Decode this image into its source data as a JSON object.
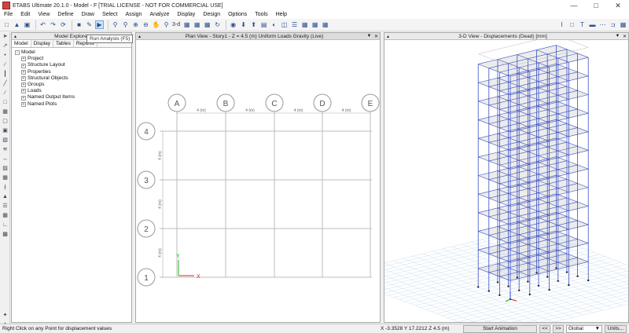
{
  "window": {
    "title": "ETABS Ultimate 20.1.0 - Model - F  [TRIAL LICENSE - NOT FOR COMMERCIAL USE]"
  },
  "menu": [
    "File",
    "Edit",
    "View",
    "Define",
    "Draw",
    "Select",
    "Assign",
    "Analyze",
    "Display",
    "Design",
    "Options",
    "Tools",
    "Help"
  ],
  "toolbar": {
    "view3d_label": "3-d",
    "tooltip": "Run Analysis (F5)"
  },
  "explorer": {
    "title": "Model Explorer",
    "tabs": [
      "Model",
      "Display",
      "Tables",
      "Reports"
    ],
    "root": "Model",
    "children": [
      "Project",
      "Structure Layout",
      "Properties",
      "Structural Objects",
      "Groups",
      "Loads",
      "Named Output Items",
      "Named Plots"
    ]
  },
  "plan": {
    "title": "Plan View - Story1 - Z = 4.5 (m)  Uniform Loads Gravity  (Live)",
    "grid_x": [
      "A",
      "B",
      "C",
      "D",
      "E"
    ],
    "grid_y": [
      "4",
      "3",
      "2",
      "1"
    ],
    "spacing_label": "4 (m)",
    "axis_x": "X",
    "axis_y": "Y"
  },
  "view3d": {
    "title": "3-D View  - Displacements (Dead)  [mm]",
    "stories": 12
  },
  "status": {
    "message": "Right Click on any Point for displacement values",
    "coords": "X -3.3528  Y 17.2212  Z 4.5 (m)",
    "animation_label": "Start Animation",
    "prev_label": "<<",
    "next_label": ">>",
    "coord_system": "Global",
    "units_label": "Units..."
  },
  "colors": {
    "frame": "#3a4fc0",
    "grid": "#bdbdbd",
    "axis_x": "#e02020",
    "axis_y": "#20b020",
    "surface": "#c9c9c9"
  }
}
